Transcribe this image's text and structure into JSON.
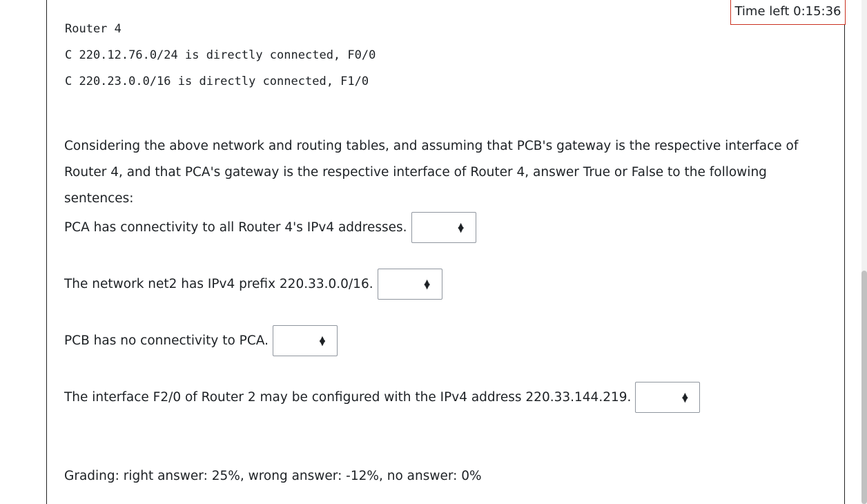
{
  "timer": {
    "label": "Time left 0:15:36"
  },
  "routing_table": {
    "title": "Router 4",
    "routes": [
      "C 220.12.76.0/24 is directly connected, F0/0",
      "C 220.23.0.0/16 is directly connected, F1/0"
    ]
  },
  "question": {
    "intro": "Considering the above network and routing tables, and assuming that PCB's gateway is the respective interface of Router 4, and that PCA's gateway is the respective interface of Router 4, answer True or False to the following sentences:"
  },
  "statements": [
    {
      "text": "PCA has connectivity to all Router 4's IPv4 addresses.",
      "selected": ""
    },
    {
      "text": "The network net2 has IPv4 prefix 220.33.0.0/16.",
      "selected": ""
    },
    {
      "text": "PCB has no connectivity to PCA.",
      "selected": ""
    },
    {
      "text": "The interface F2/0 of Router 2 may be configured with the IPv4 address 220.33.144.219.",
      "selected": ""
    }
  ],
  "grading": {
    "text": "Grading: right answer: 25%, wrong answer: -12%, no answer: 0%"
  }
}
